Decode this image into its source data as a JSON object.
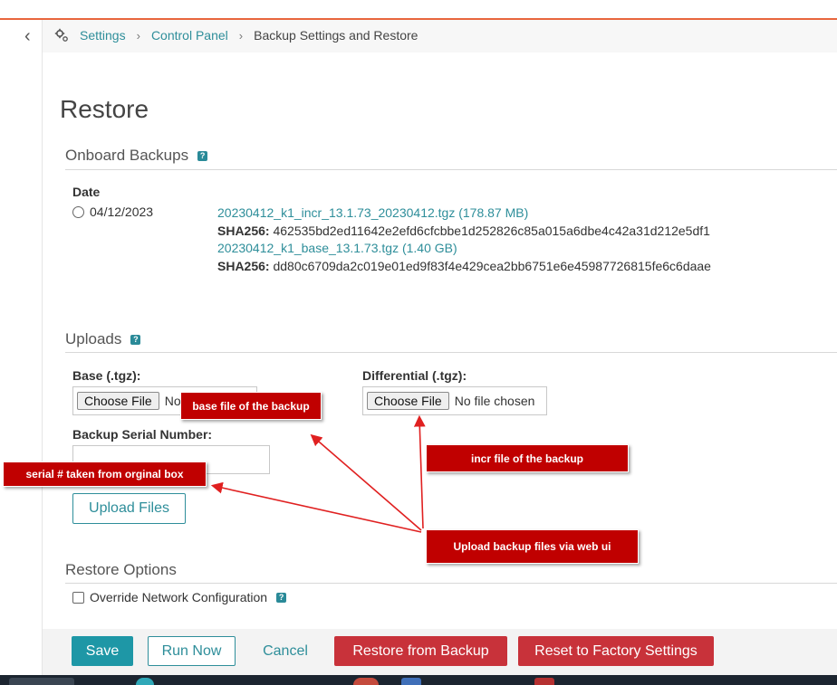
{
  "breadcrumb": {
    "items": [
      "Settings",
      "Control Panel"
    ],
    "current": "Backup Settings and Restore",
    "separator": "›"
  },
  "page": {
    "title": "Restore"
  },
  "onboard": {
    "heading": "Onboard Backups",
    "help": "?",
    "date_label": "Date",
    "date_value": "04/12/2023",
    "files": [
      {
        "name": "20230412_k1_incr_13.1.73_20230412.tgz (178.87 MB)",
        "sha_label": "SHA256:",
        "sha": "462535bd2ed11642e2efd6cfcbbe1d252826c85a015a6dbe4c42a31d212e5df1"
      },
      {
        "name": "20230412_k1_base_13.1.73.tgz (1.40 GB)",
        "sha_label": "SHA256:",
        "sha": "dd80c6709da2c019e01ed9f83f4e429cea2bb6751e6e45987726815fe6c6daae"
      }
    ]
  },
  "uploads": {
    "heading": "Uploads",
    "help": "?",
    "base_label": "Base (.tgz):",
    "base_button": "Choose File",
    "base_status": "No",
    "diff_label": "Differential (.tgz):",
    "diff_button": "Choose File",
    "diff_status": "No file chosen",
    "serial_label": "Backup Serial Number:",
    "serial_value": "",
    "upload_button": "Upload Files"
  },
  "restore_options": {
    "heading": "Restore Options",
    "override_label": "Override Network Configuration",
    "help": "?"
  },
  "footer": {
    "save": "Save",
    "run_now": "Run Now",
    "cancel": "Cancel",
    "restore": "Restore from Backup",
    "reset": "Reset to Factory Settings"
  },
  "annotations": {
    "base_file": "base file of the backup",
    "serial": "serial # taken from orginal box",
    "incr_file": "incr file of the backup",
    "upload": "Upload backup files via web ui"
  },
  "icons": {
    "back": "chevron-left-icon",
    "settings": "gear-icon",
    "help": "help-icon"
  },
  "colors": {
    "accent": "#1e97a6",
    "link": "#2e8e9a",
    "danger": "#c8323a",
    "callout": "#c00000",
    "top_line": "#e8663d"
  }
}
